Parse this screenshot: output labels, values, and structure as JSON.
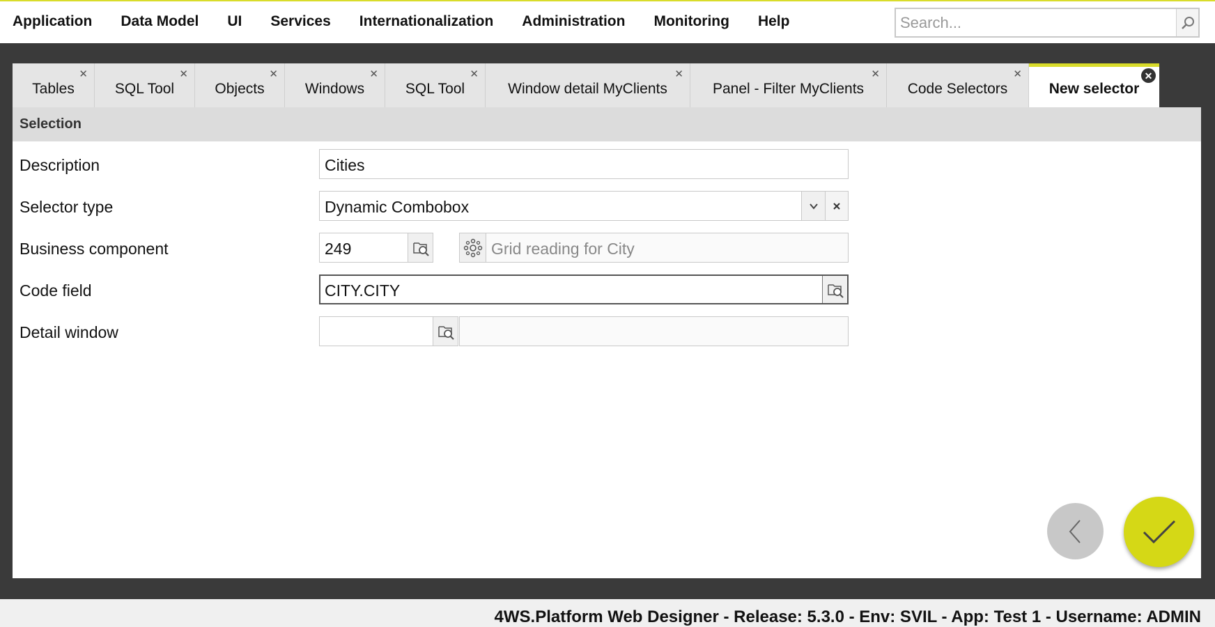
{
  "menu": {
    "items": [
      "Application",
      "Data Model",
      "UI",
      "Services",
      "Internationalization",
      "Administration",
      "Monitoring",
      "Help"
    ]
  },
  "search": {
    "placeholder": "Search..."
  },
  "tabs": [
    {
      "label": "Tables",
      "active": false
    },
    {
      "label": "SQL Tool",
      "active": false
    },
    {
      "label": "Objects",
      "active": false
    },
    {
      "label": "Windows",
      "active": false
    },
    {
      "label": "SQL Tool",
      "active": false
    },
    {
      "label": "Window detail MyClients",
      "active": false
    },
    {
      "label": "Panel - Filter MyClients",
      "active": false
    },
    {
      "label": "Code Selectors",
      "active": false
    },
    {
      "label": "New selector",
      "active": true
    }
  ],
  "panel": {
    "section_title": "Selection",
    "description": {
      "label": "Description",
      "value": "Cities"
    },
    "selector_type": {
      "label": "Selector type",
      "value": "Dynamic Combobox"
    },
    "business_component": {
      "label": "Business component",
      "value": "249",
      "name": "Grid reading for City"
    },
    "code_field": {
      "label": "Code field",
      "value": "CITY.CITY"
    },
    "detail_window": {
      "label": "Detail window",
      "value": "",
      "name": ""
    }
  },
  "footer": {
    "text": "4WS.Platform Web Designer - Release: 5.3.0 - Env: SVIL - App: Test 1 - Username: ADMIN"
  },
  "colors": {
    "accent": "#d5d816",
    "background": "#3a3a3a"
  },
  "icons": {
    "search": "magnifier-icon",
    "lookup": "lookup-search-icon",
    "component": "component-gear-icon",
    "dropdown": "chevron-down-icon",
    "clear": "clear-x-icon",
    "back": "chevron-left-icon",
    "confirm": "checkmark-icon",
    "tab_close": "close-icon"
  }
}
